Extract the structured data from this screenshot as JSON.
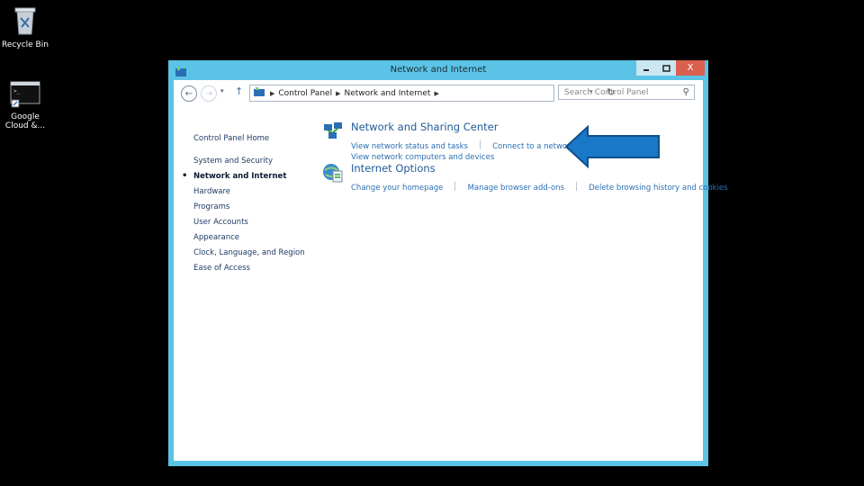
{
  "desktop": {
    "recycle_bin": "Recycle Bin",
    "google_cloud": "Google\nCloud &..."
  },
  "window": {
    "title": "Network and Internet",
    "close_label": "X"
  },
  "address": {
    "crumbs": [
      "Control Panel",
      "Network and Internet"
    ],
    "search_placeholder": "Search Control Panel"
  },
  "leftnav": {
    "home": "Control Panel Home",
    "items": [
      "System and Security",
      "Network and Internet",
      "Hardware",
      "Programs",
      "User Accounts",
      "Appearance",
      "Clock, Language, and Region",
      "Ease of Access"
    ]
  },
  "categories": [
    {
      "title": "Network and Sharing Center",
      "links": [
        "View network status and tasks",
        "Connect to a network",
        "View network computers and devices"
      ]
    },
    {
      "title": "Internet Options",
      "links": [
        "Change your homepage",
        "Manage browser add-ons",
        "Delete browsing history and cookies"
      ]
    }
  ],
  "colors": {
    "accent": "#5bc3e6",
    "link": "#2a6fb5",
    "arrow": "#1a78c8"
  }
}
